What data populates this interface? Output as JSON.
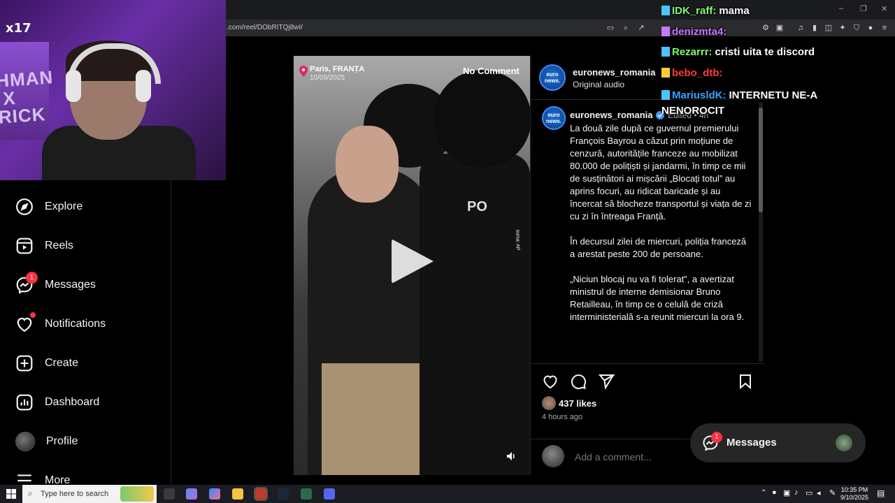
{
  "browser": {
    "url": ".com/reel/DObRITQj8wI/"
  },
  "webcam": {
    "logo": "x17",
    "sign_text": "HMAN\nX\nRICK"
  },
  "sidebar": {
    "items": [
      {
        "label": "Explore",
        "icon": "compass-icon"
      },
      {
        "label": "Reels",
        "icon": "reels-icon"
      },
      {
        "label": "Messages",
        "icon": "messenger-icon",
        "badge": "1"
      },
      {
        "label": "Notifications",
        "icon": "heart-icon"
      },
      {
        "label": "Create",
        "icon": "plus-square-icon"
      },
      {
        "label": "Dashboard",
        "icon": "dashboard-icon"
      },
      {
        "label": "Profile",
        "icon": "avatar"
      },
      {
        "label": "More",
        "icon": "menu-icon"
      }
    ]
  },
  "video": {
    "location": "Paris, FRANȚA",
    "date": "10/09/2025",
    "watermark": "No Comment",
    "credit": "sursa: AP"
  },
  "post": {
    "account": "euronews_romania",
    "audio": "Original audio",
    "logo_text": "euro news.",
    "caption_meta": "Edited • 4h",
    "caption": [
      "La două zile după ce guvernul premierului François Bayrou a căzut prin moțiune de cenzură, autoritățile franceze au mobilizat 80.000 de polițiști și jandarmi, în timp ce mii de susținători ai mișcării „Blocați totul” au aprins focuri, au ridicat baricade și au încercat să blocheze transportul și viața de zi cu zi în întreaga Franță.",
      "În decursul zilei de miercuri, poliția franceză a arestat peste 200 de persoane.",
      "„Niciun blocaj nu va fi tolerat”, a avertizat ministrul de interne demisionar Bruno Retailleau, în timp ce o celulă de criză interministerială s-a reunit miercuri la ora 9."
    ],
    "likes": "437 likes",
    "time_ago": "4 hours ago",
    "comment_placeholder": "Add a comment..."
  },
  "floating_messages": {
    "label": "Messages",
    "badge": "1"
  },
  "chat": [
    {
      "user": "IDK_raff:",
      "text": "mama",
      "color": "#7cff6b"
    },
    {
      "user": "denizmta4:",
      "text": "",
      "color": "#c778ff"
    },
    {
      "user": "Rezarrr:",
      "text": "cristi uita te discord",
      "color": "#7cff6b"
    },
    {
      "user": "bebo_dtb:",
      "text": "",
      "color": "#ff3a3a"
    },
    {
      "user": "MariusldK:",
      "text": "INTERNETU NE-A NENOROCIT",
      "color": "#3aa0ff"
    }
  ],
  "taskbar": {
    "search_placeholder": "Type here to search",
    "time": "10:35 PM",
    "date": "9/10/2025"
  }
}
